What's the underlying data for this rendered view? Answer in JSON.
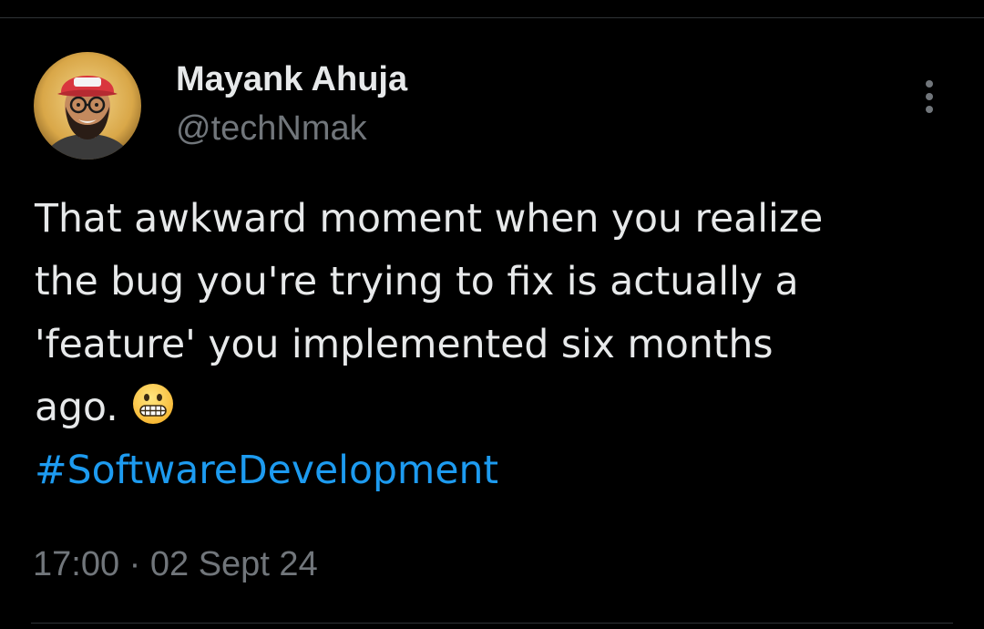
{
  "author": {
    "name": "Mayank Ahuja",
    "handle": "@techNmak"
  },
  "tweet": {
    "lines": [
      "That awkward moment when you realize",
      "the bug you're trying to fix is actually a",
      "'feature' you implemented six months",
      "ago."
    ],
    "emoji": "grimacing-face-emoji",
    "hashtag": "#SoftwareDevelopment"
  },
  "meta": {
    "time": "17:00",
    "separator": " · ",
    "date": "02 Sept 24"
  },
  "icons": {
    "more": "more-vertical-icon"
  },
  "colors": {
    "background": "#000000",
    "text": "#e7e9ea",
    "secondary": "#71767b",
    "link": "#1d9bf0",
    "divider": "#2f3336"
  }
}
